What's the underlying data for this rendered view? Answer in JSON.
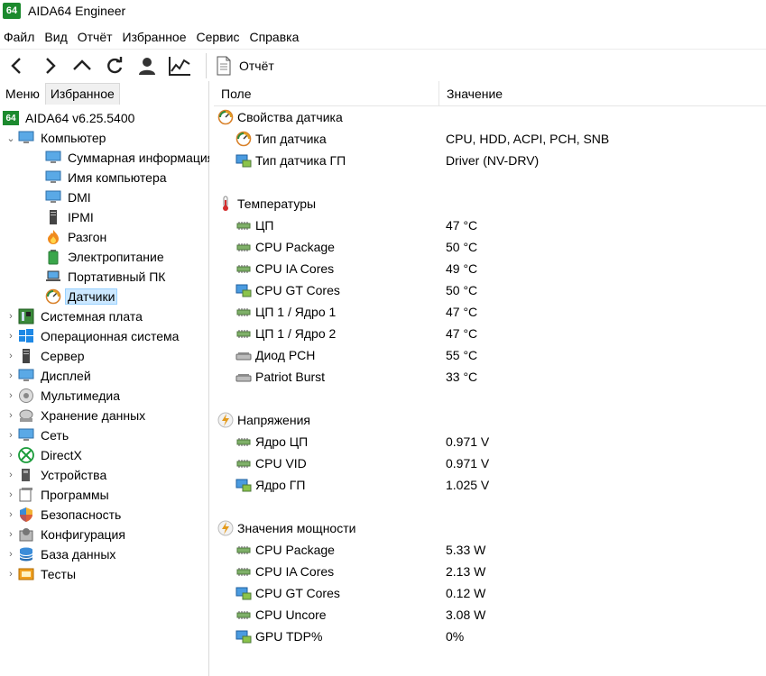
{
  "app": {
    "logo": "64",
    "title": "AIDA64 Engineer"
  },
  "menubar": [
    "Файл",
    "Вид",
    "Отчёт",
    "Избранное",
    "Сервис",
    "Справка"
  ],
  "toolbar": {
    "buttons": [
      "back-icon",
      "forward-icon",
      "up-icon",
      "refresh-icon",
      "user-icon",
      "chart-icon"
    ],
    "report_label": "Отчёт"
  },
  "tabs": [
    "Меню",
    "Избранное"
  ],
  "tree": {
    "root_label": "AIDA64 v6.25.5400",
    "computer_label": "Компьютер",
    "computer_children": [
      "Суммарная информация",
      "Имя компьютера",
      "DMI",
      "IPMI",
      "Разгон",
      "Электропитание",
      "Портативный ПК",
      "Датчики"
    ],
    "categories": [
      "Системная плата",
      "Операционная система",
      "Сервер",
      "Дисплей",
      "Мультимедиа",
      "Хранение данных",
      "Сеть",
      "DirectX",
      "Устройства",
      "Программы",
      "Безопасность",
      "Конфигурация",
      "База данных",
      "Тесты"
    ]
  },
  "columns": {
    "field": "Поле",
    "value": "Значение"
  },
  "groups": {
    "sensor_props": {
      "title": "Свойства датчика",
      "items": [
        {
          "field": "Тип датчика",
          "value": "CPU, HDD, ACPI, PCH, SNB"
        },
        {
          "field": "Тип датчика ГП",
          "value": "Driver  (NV-DRV)"
        }
      ]
    },
    "temps": {
      "title": "Температуры",
      "items": [
        {
          "field": "ЦП",
          "value": "47 °C"
        },
        {
          "field": "CPU Package",
          "value": "50 °C"
        },
        {
          "field": "CPU IA Cores",
          "value": "49 °C"
        },
        {
          "field": "CPU GT Cores",
          "value": "50 °C"
        },
        {
          "field": "ЦП 1 / Ядро 1",
          "value": "47 °C"
        },
        {
          "field": "ЦП 1 / Ядро 2",
          "value": "47 °C"
        },
        {
          "field": "Диод PCH",
          "value": "55 °C"
        },
        {
          "field": "Patriot Burst",
          "value": "33 °C"
        }
      ]
    },
    "voltages": {
      "title": "Напряжения",
      "items": [
        {
          "field": "Ядро ЦП",
          "value": "0.971 V"
        },
        {
          "field": "CPU VID",
          "value": "0.971 V"
        },
        {
          "field": "Ядро ГП",
          "value": "1.025 V"
        }
      ]
    },
    "power": {
      "title": "Значения мощности",
      "items": [
        {
          "field": "CPU Package",
          "value": "5.33 W"
        },
        {
          "field": "CPU IA Cores",
          "value": "2.13 W"
        },
        {
          "field": "CPU GT Cores",
          "value": "0.12 W"
        },
        {
          "field": "CPU Uncore",
          "value": "3.08 W"
        },
        {
          "field": "GPU TDP%",
          "value": "0%"
        }
      ]
    }
  },
  "colors": {
    "logo_green": "#1c8a2e",
    "selection": "#cce8ff",
    "chip_green": "#6aa84f",
    "gpu_blue": "#2a7fd4"
  }
}
